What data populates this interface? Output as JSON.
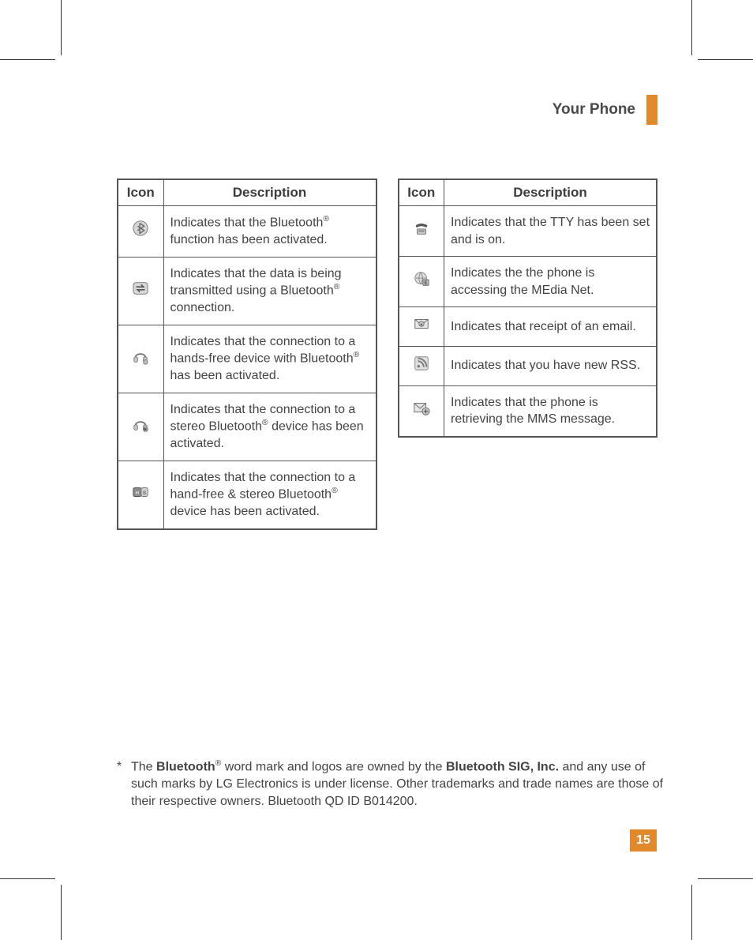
{
  "header": {
    "section_title": "Your Phone"
  },
  "tables": {
    "headers": {
      "icon": "Icon",
      "description": "Description"
    },
    "left": [
      {
        "icon_name": "bluetooth-icon",
        "desc_pre": "Indicates that the Bluetooth",
        "sup": "®",
        "desc_post": " function has been activated."
      },
      {
        "icon_name": "bluetooth-transfer-icon",
        "desc_pre": "Indicates that the data is being transmitted using a Bluetooth",
        "sup": "®",
        "desc_post": " connection."
      },
      {
        "icon_name": "bluetooth-headset-icon",
        "desc_pre": "Indicates that the connection to a hands-free device with Bluetooth",
        "sup": "®",
        "desc_post": " has been activated."
      },
      {
        "icon_name": "bluetooth-stereo-icon",
        "desc_pre": "Indicates that the connection to a stereo Bluetooth",
        "sup": "®",
        "desc_post": " device has been activated."
      },
      {
        "icon_name": "bluetooth-combo-icon",
        "desc_pre": "Indicates that the connection to a hand-free & stereo Bluetooth",
        "sup": "®",
        "desc_post": " device has been activated."
      }
    ],
    "right": [
      {
        "icon_name": "tty-icon",
        "desc": "Indicates that the TTY has been set and is on."
      },
      {
        "icon_name": "medianet-icon",
        "desc": "Indicates the the phone is accessing the MEdia Net."
      },
      {
        "icon_name": "email-icon",
        "desc": "Indicates that receipt of an email."
      },
      {
        "icon_name": "rss-icon",
        "desc": "Indicates that you have new RSS."
      },
      {
        "icon_name": "mms-icon",
        "desc": "Indicates that the phone is retrieving the MMS message."
      }
    ]
  },
  "footnote": {
    "marker": "*",
    "pre": "The ",
    "bold1": "Bluetooth",
    "sup": "®",
    "mid": " word mark and logos are owned by the ",
    "bold2": "Bluetooth SIG, Inc.",
    "post": " and any use of such marks by LG Electronics is under license. Other trademarks and trade names are those of their respective owners. Bluetooth QD ID B014200."
  },
  "page_number": "15"
}
